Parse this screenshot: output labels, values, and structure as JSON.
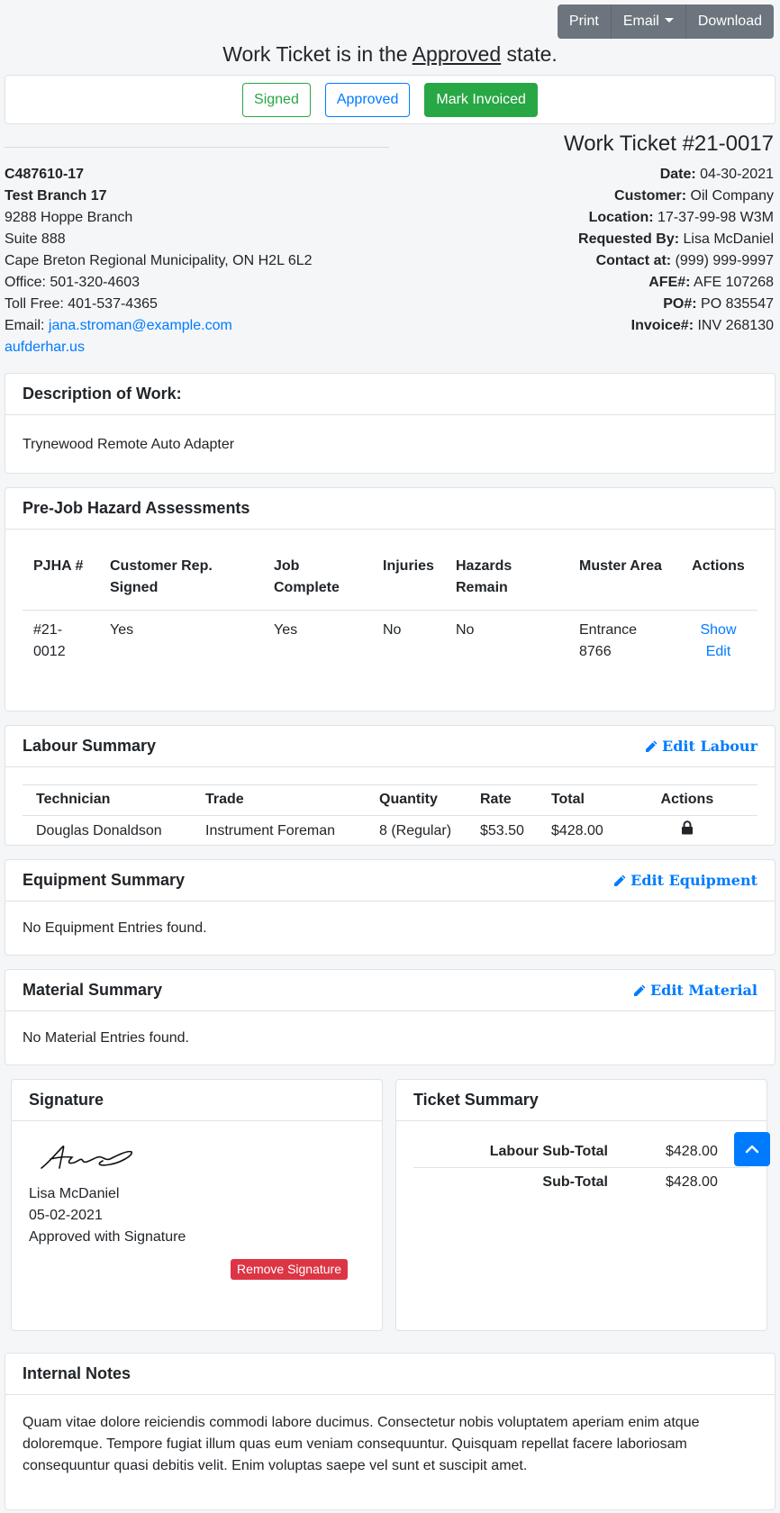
{
  "toolbar": {
    "print": "Print",
    "email": "Email",
    "download": "Download"
  },
  "state": {
    "prefix": "Work Ticket is in the",
    "value": "Approved",
    "suffix": "state."
  },
  "state_buttons": {
    "signed": "Signed",
    "approved": "Approved",
    "mark_invoiced": "Mark Invoiced"
  },
  "company": {
    "code": "C487610-17",
    "name": "Test Branch 17",
    "address1": "9288 Hoppe Branch",
    "address2": "Suite 888",
    "city": "Cape Breton Regional Municipality, ON H2L 6L2",
    "office": "Office: 501-320-4603",
    "tollfree": "Toll Free: 401-537-4365",
    "email_label": "Email:",
    "email": "jana.stroman@example.com",
    "website": "aufderhar.us"
  },
  "ticket": {
    "title": "Work Ticket #21-0017",
    "meta": [
      {
        "label": "Date:",
        "value": "04-30-2021"
      },
      {
        "label": "Customer:",
        "value": "Oil Company"
      },
      {
        "label": "Location:",
        "value": "17-37-99-98 W3M"
      },
      {
        "label": "Requested By:",
        "value": "Lisa McDaniel"
      },
      {
        "label": "Contact at:",
        "value": "(999) 999-9997"
      },
      {
        "label": "AFE#:",
        "value": "AFE 107268"
      },
      {
        "label": "PO#:",
        "value": "PO 835547"
      },
      {
        "label": "Invoice#:",
        "value": "INV 268130"
      }
    ]
  },
  "description": {
    "title": "Description of Work:",
    "text": "Trynewood Remote Auto Adapter"
  },
  "pjha": {
    "title": "Pre-Job Hazard Assessments",
    "headers": [
      "PJHA #",
      "Customer Rep. Signed",
      "Job Complete",
      "Injuries",
      "Hazards Remain",
      "Muster Area",
      "Actions"
    ],
    "rows": [
      {
        "num": "#21-0012",
        "rep_signed": "Yes",
        "complete": "Yes",
        "injuries": "No",
        "hazards": "No",
        "muster": "Entrance 8766",
        "show": "Show",
        "edit": "Edit"
      }
    ]
  },
  "labour": {
    "title": "Labour Summary",
    "edit": "Edit Labour",
    "headers": [
      "Technician",
      "Trade",
      "Quantity",
      "Rate",
      "Total",
      "Actions"
    ],
    "rows": [
      {
        "tech": "Douglas Donaldson",
        "trade": "Instrument Foreman",
        "qty": "8 (Regular)",
        "rate": "$53.50",
        "total": "$428.00",
        "action_icon": "lock-icon"
      }
    ]
  },
  "equipment": {
    "title": "Equipment Summary",
    "edit": "Edit Equipment",
    "empty": "No Equipment Entries found."
  },
  "material": {
    "title": "Material Summary",
    "edit": "Edit Material",
    "empty": "No Material Entries found."
  },
  "signature": {
    "title": "Signature",
    "name": "Lisa McDaniel",
    "date": "05-02-2021",
    "status": "Approved with Signature",
    "remove": "Remove Signature"
  },
  "summary": {
    "title": "Ticket Summary",
    "rows": [
      {
        "label": "Labour Sub-Total",
        "value": "$428.00"
      },
      {
        "label": "Sub-Total",
        "value": "$428.00"
      }
    ]
  },
  "notes": {
    "title": "Internal Notes",
    "text": "Quam vitae dolore reiciendis commodi labore ducimus. Consectetur nobis voluptatem aperiam enim atque doloremque. Tempore fugiat illum quas eum veniam consequuntur. Quisquam repellat facere laboriosam consequuntur quasi debitis velit. Enim voluptas saepe vel sunt et suscipit amet."
  },
  "colors": {
    "primary": "#007bff",
    "success": "#28a745",
    "danger": "#dc3545",
    "secondary": "#6c757d"
  }
}
